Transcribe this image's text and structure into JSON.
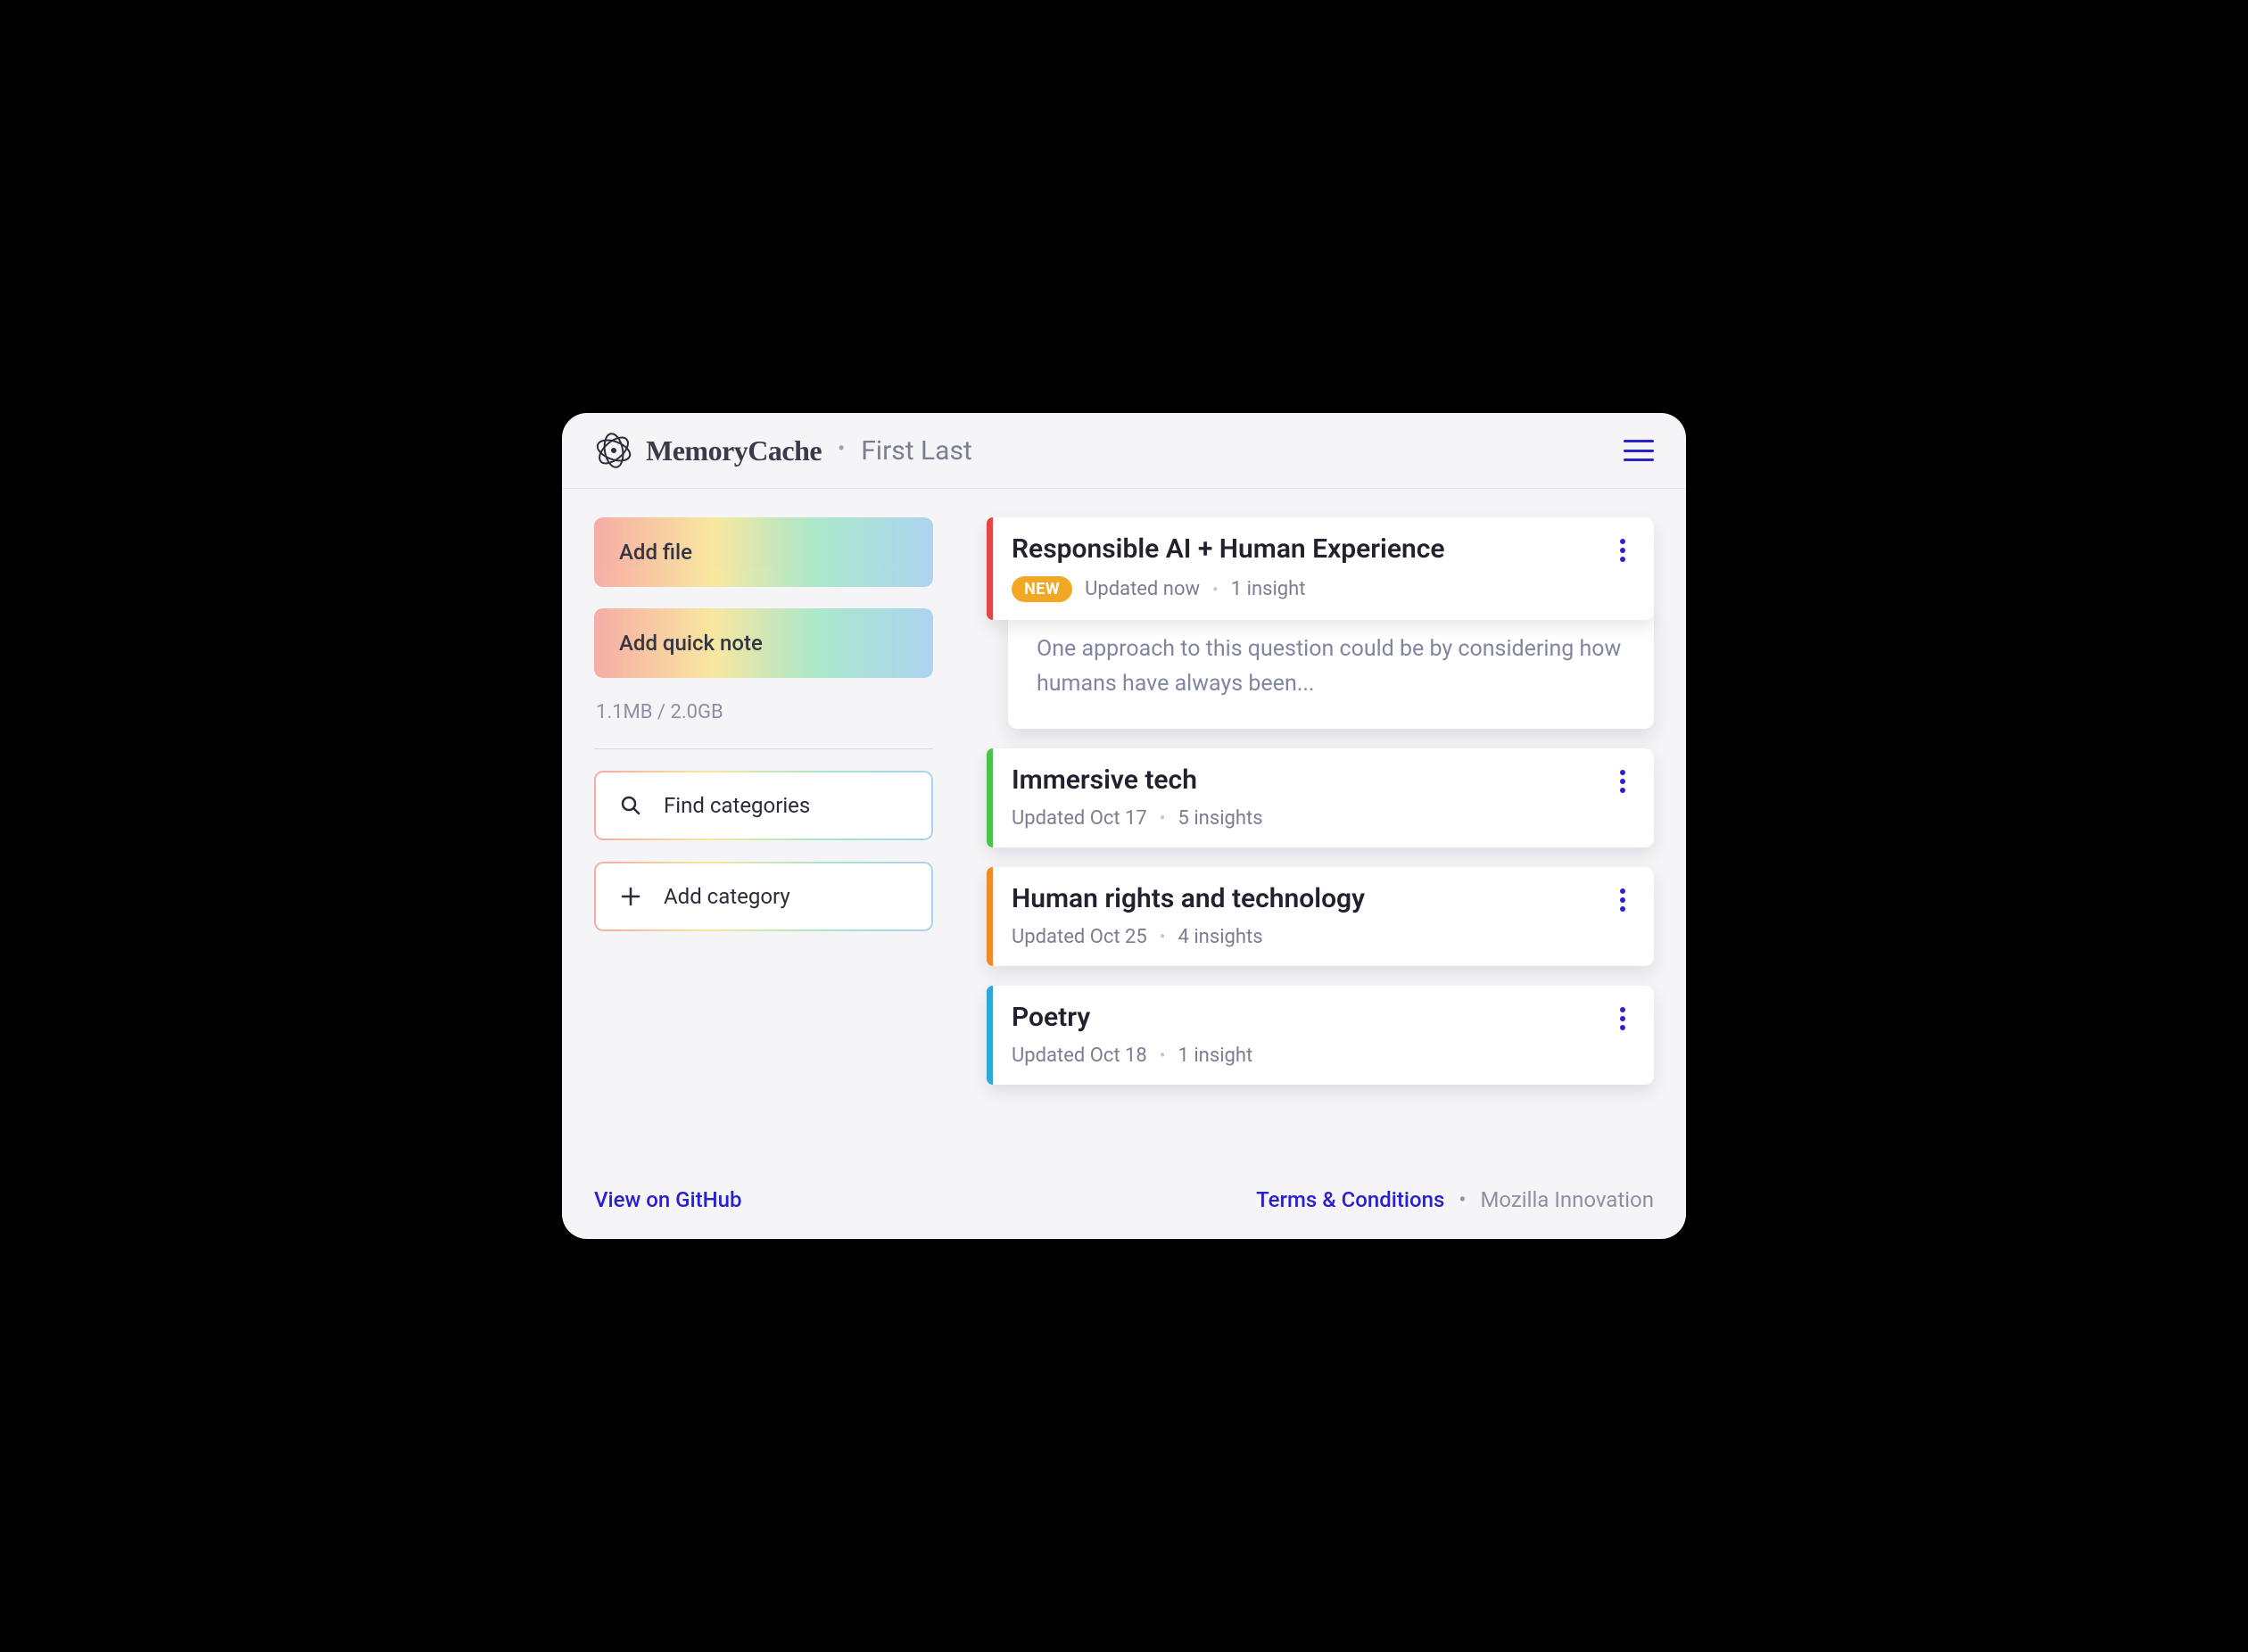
{
  "header": {
    "brand": "MemoryCache",
    "user_name": "First Last",
    "menu_icon": "hamburger-icon"
  },
  "sidebar": {
    "add_file_label": "Add file",
    "add_note_label": "Add quick note",
    "storage_used": "1.1MB",
    "storage_total": "2.0GB",
    "find_categories_label": "Find categories",
    "add_category_label": "Add category"
  },
  "cards": [
    {
      "stripe_color": "#e64545",
      "title": "Responsible AI + Human Experience",
      "is_new": true,
      "new_badge": "NEW",
      "updated": "Updated now",
      "insights": "1 insight",
      "insight_preview": "One approach to this question could be by considering how humans have always been..."
    },
    {
      "stripe_color": "#4bc24b",
      "title": "Immersive tech",
      "is_new": false,
      "updated": "Updated Oct 17",
      "insights": "5 insights"
    },
    {
      "stripe_color": "#f08b2c",
      "title": "Human rights and technology",
      "is_new": false,
      "updated": "Updated Oct 25",
      "insights": "4 insights"
    },
    {
      "stripe_color": "#2da8d8",
      "title": "Poetry",
      "is_new": false,
      "updated": "Updated Oct 18",
      "insights": "1 insight"
    }
  ],
  "footer": {
    "github_label": "View on GitHub",
    "terms_label": "Terms & Conditions",
    "org_label": "Mozilla Innovation"
  }
}
